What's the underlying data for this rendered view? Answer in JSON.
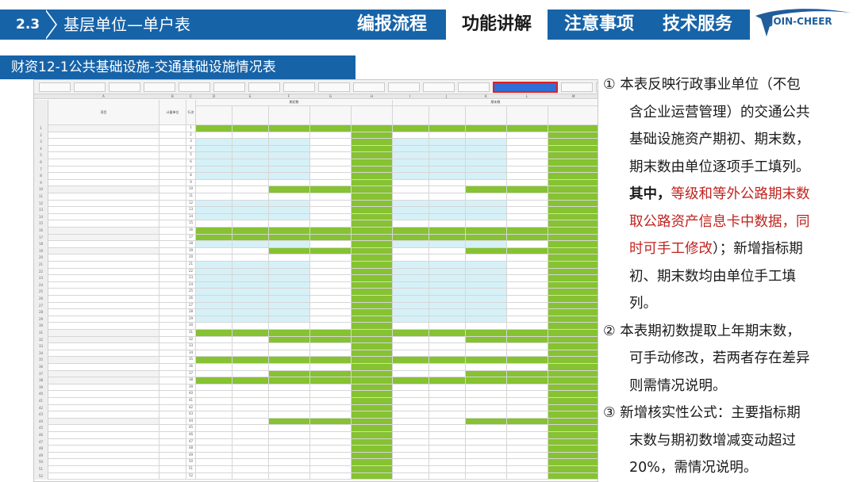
{
  "header": {
    "section_number": "2.3",
    "section_title": "基层单位—单户表",
    "nav": [
      {
        "label": "编报流程",
        "active": false
      },
      {
        "label": "功能讲解",
        "active": true
      },
      {
        "label": "注意事项",
        "active": false
      },
      {
        "label": "技术服务",
        "active": false
      }
    ],
    "logo_text": "JOIN-CHEER"
  },
  "subtitle": "财资12-1公共基础设施-交通基础设施情况表",
  "notes": {
    "n1_marker": "①",
    "n1_line1": "本表反映行政事业单位（不包",
    "n1_line2": "含企业运营管理）的交通公共",
    "n1_line3": "基础设施资产期初、期末数，",
    "n1_line4": "期末数由单位逐项手工填列。",
    "n1_bold": "其中，",
    "n1_red1": "等级和等外公路期末数",
    "n1_red2": "取公路资产信息卡中数据，同",
    "n1_red3": "时可手工修改",
    "n1_tail": "）；新增指标期",
    "n1_line9": "初、期末数均由单位手工填",
    "n1_line10": "列。",
    "n2_marker": "②",
    "n2_line1": "本表期初数提取上年期末数，",
    "n2_line2": "可手动修改，若两者存在差异",
    "n2_line3": "则需情况说明。",
    "n3_marker": "③",
    "n3_line1": "新增核实性公式：主要指标期",
    "n3_line2": "末数与期初数增减变动超过",
    "n3_line3": "20%，需情况说明。"
  },
  "sheet": {
    "colors": {
      "green": "#86c232",
      "cyan": "#d5f1f7",
      "selected_tab": "#2f6fd6",
      "selected_tab_border": "#e02020"
    },
    "column_letters": [
      "A",
      "B",
      "C",
      "D",
      "E",
      "F",
      "G",
      "H",
      "I",
      "J",
      "K",
      "L",
      "M"
    ],
    "header_labels": {
      "item": "项目",
      "unit": "计量单位",
      "row": "行次",
      "begin": "期初数",
      "end": "期末数"
    },
    "row_numbers": [
      "1",
      "2",
      "3",
      "4",
      "5",
      "6",
      "7",
      "8",
      "9",
      "10",
      "11",
      "12",
      "13",
      "14",
      "15",
      "16",
      "17",
      "18",
      "19",
      "20",
      "21",
      "22",
      "23",
      "24",
      "25",
      "26",
      "27",
      "28",
      "29",
      "30",
      "31",
      "32",
      "33",
      "34",
      "35",
      "36",
      "37",
      "38",
      "39",
      "40",
      "41",
      "42",
      "43",
      "44",
      "45",
      "46",
      "47",
      "48",
      "49",
      "50",
      "51",
      "52"
    ],
    "row_line_numbers": [
      "1",
      "2",
      "3",
      "4",
      "5",
      "6",
      "7",
      "8",
      "9",
      "10",
      "11",
      "12",
      "13",
      "14",
      "15",
      "16",
      "17",
      "18",
      "19",
      "20",
      "21",
      "22",
      "23",
      "24",
      "25",
      "26",
      "27",
      "28",
      "29",
      "30",
      "31",
      "32",
      "33",
      "34",
      "35",
      "36",
      "37",
      "38",
      "39",
      "40",
      "41",
      "42",
      "43",
      "44",
      "45",
      "46",
      "47",
      "48",
      "49",
      "50",
      "51",
      "52"
    ]
  }
}
